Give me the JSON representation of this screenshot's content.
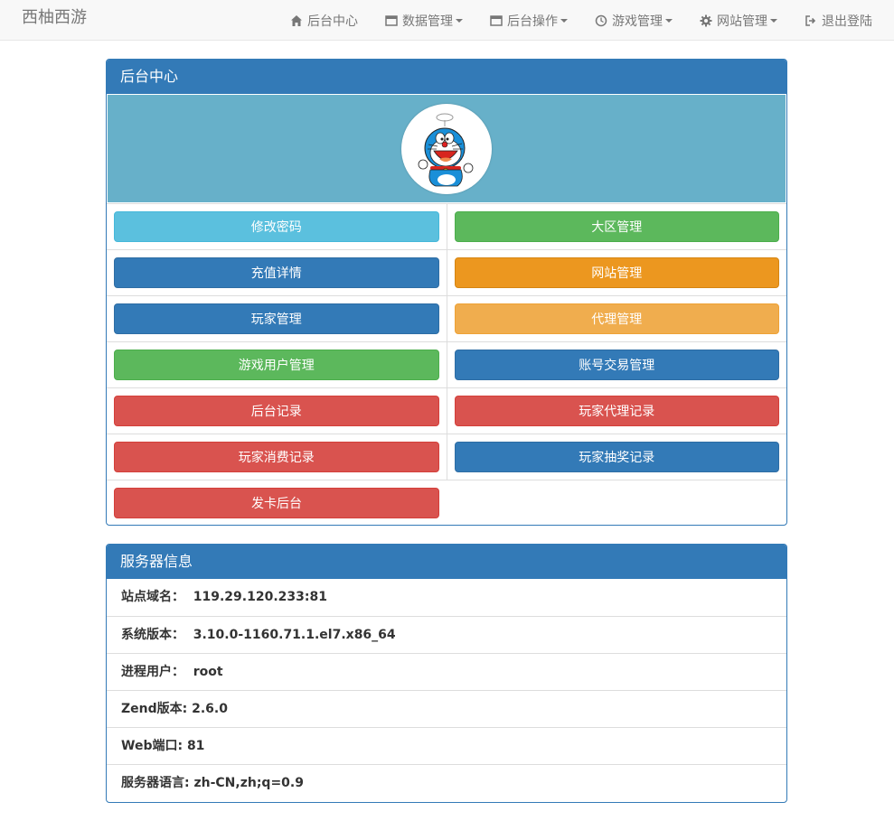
{
  "brand": "西柚西游",
  "nav": [
    {
      "label": "后台中心",
      "icon": "home-icon",
      "dropdown": false
    },
    {
      "label": "数据管理",
      "icon": "window-icon",
      "dropdown": true
    },
    {
      "label": "后台操作",
      "icon": "window-icon",
      "dropdown": true
    },
    {
      "label": "游戏管理",
      "icon": "clock-icon",
      "dropdown": true
    },
    {
      "label": "网站管理",
      "icon": "gear-icon",
      "dropdown": true
    },
    {
      "label": "退出登陆",
      "icon": "logout-icon",
      "dropdown": false
    }
  ],
  "admin_panel": {
    "title": "后台中心",
    "avatar": "doraemon-avatar",
    "buttons": [
      [
        "修改密码",
        "大区管理"
      ],
      [
        "充值详情",
        "网站管理"
      ],
      [
        "玩家管理",
        "代理管理"
      ],
      [
        "游戏用户管理",
        "账号交易管理"
      ],
      [
        "后台记录",
        "玩家代理记录"
      ],
      [
        "玩家消费记录",
        "玩家抽奖记录"
      ],
      [
        "发卡后台",
        ""
      ]
    ],
    "colors": {
      "info": "#5bc0de",
      "success": "#5cb85c",
      "primary": "#337ab7",
      "warning": "#ec971f",
      "warning_light": "#f0ad4e",
      "danger": "#d9534f"
    }
  },
  "server_panel": {
    "title": "服务器信息",
    "items": [
      {
        "label": "站点域名：",
        "value": "119.29.120.233:81"
      },
      {
        "label": "系统版本：",
        "value": "3.10.0-1160.71.1.el7.x86_64"
      },
      {
        "label": "进程用户：",
        "value": "root"
      },
      {
        "label": "Zend版本:",
        "value": "2.6.0"
      },
      {
        "label": "Web端口:",
        "value": "81"
      },
      {
        "label": "服务器语言:",
        "value": "zh-CN,zh;q=0.9"
      }
    ]
  }
}
